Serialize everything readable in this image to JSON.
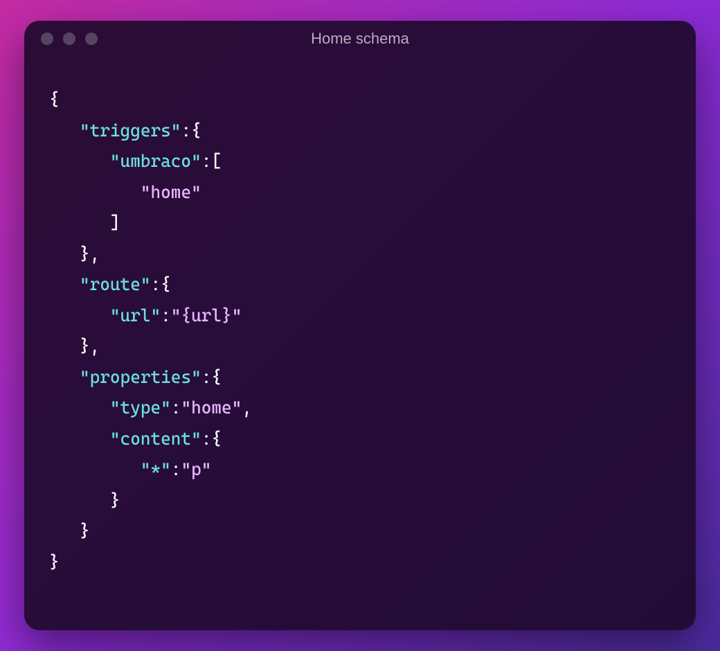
{
  "window": {
    "title": "Home schema"
  },
  "code": {
    "lines": [
      {
        "tokens": [
          {
            "cls": "punc",
            "text": "{"
          }
        ]
      },
      {
        "tokens": [
          {
            "cls": "punc",
            "text": "   "
          },
          {
            "cls": "key",
            "text": "\"triggers\""
          },
          {
            "cls": "punc",
            "text": ":{"
          }
        ]
      },
      {
        "tokens": [
          {
            "cls": "punc",
            "text": "      "
          },
          {
            "cls": "key",
            "text": "\"umbraco\""
          },
          {
            "cls": "punc",
            "text": ":["
          }
        ]
      },
      {
        "tokens": [
          {
            "cls": "punc",
            "text": "         "
          },
          {
            "cls": "str",
            "text": "\"home\""
          }
        ]
      },
      {
        "tokens": [
          {
            "cls": "punc",
            "text": "      ]"
          }
        ]
      },
      {
        "tokens": [
          {
            "cls": "punc",
            "text": "   },"
          }
        ]
      },
      {
        "tokens": [
          {
            "cls": "punc",
            "text": "   "
          },
          {
            "cls": "key",
            "text": "\"route\""
          },
          {
            "cls": "punc",
            "text": ":{"
          }
        ]
      },
      {
        "tokens": [
          {
            "cls": "punc",
            "text": "      "
          },
          {
            "cls": "key",
            "text": "\"url\""
          },
          {
            "cls": "punc",
            "text": ":"
          },
          {
            "cls": "str",
            "text": "\"{url}\""
          }
        ]
      },
      {
        "tokens": [
          {
            "cls": "punc",
            "text": "   },"
          }
        ]
      },
      {
        "tokens": [
          {
            "cls": "punc",
            "text": "   "
          },
          {
            "cls": "key",
            "text": "\"properties\""
          },
          {
            "cls": "punc",
            "text": ":{"
          }
        ]
      },
      {
        "tokens": [
          {
            "cls": "punc",
            "text": "      "
          },
          {
            "cls": "key",
            "text": "\"type\""
          },
          {
            "cls": "punc",
            "text": ":"
          },
          {
            "cls": "str",
            "text": "\"home\""
          },
          {
            "cls": "punc",
            "text": ","
          }
        ]
      },
      {
        "tokens": [
          {
            "cls": "punc",
            "text": "      "
          },
          {
            "cls": "key",
            "text": "\"content\""
          },
          {
            "cls": "punc",
            "text": ":{"
          }
        ]
      },
      {
        "tokens": [
          {
            "cls": "punc",
            "text": "         "
          },
          {
            "cls": "key",
            "text": "\"*\""
          },
          {
            "cls": "punc",
            "text": ":"
          },
          {
            "cls": "str",
            "text": "\"p\""
          }
        ]
      },
      {
        "tokens": [
          {
            "cls": "punc",
            "text": "      }"
          }
        ]
      },
      {
        "tokens": [
          {
            "cls": "punc",
            "text": "   }"
          }
        ]
      },
      {
        "tokens": [
          {
            "cls": "punc",
            "text": "}"
          }
        ]
      }
    ]
  }
}
